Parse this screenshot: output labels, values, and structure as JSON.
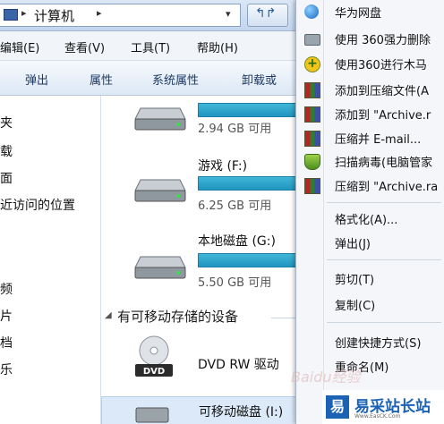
{
  "address_bar": {
    "path": "计算机",
    "arrow": "▸",
    "dropdown": "▾",
    "refresh": "↰↱"
  },
  "menu": {
    "items": [
      "编辑(E)",
      "查看(V)",
      "工具(T)",
      "帮助(H)"
    ]
  },
  "toolbar": {
    "buttons": [
      "弹出",
      "属性",
      "系统属性",
      "卸载或"
    ]
  },
  "nav_pane": {
    "items": [
      "夹",
      "载",
      "面",
      "近访问的位置",
      "频",
      "片",
      "档",
      "乐"
    ]
  },
  "drives": [
    {
      "name": "",
      "free": "2.94 GB 可用",
      "icon": "hard-drive-icon"
    },
    {
      "name": "游戏 (F:)",
      "free": "6.25 GB 可用",
      "icon": "hard-drive-icon"
    },
    {
      "name": "本地磁盘 (G:)",
      "free": "5.50 GB 可用",
      "icon": "hard-drive-icon"
    }
  ],
  "removable_group": {
    "header": "有可移动存储的设备",
    "items": [
      {
        "name": "DVD RW 驱动",
        "icon": "dvd-drive-icon",
        "badge": "DVD"
      },
      {
        "name": "可移动磁盘 (I:)",
        "icon": "removable-disk-icon"
      }
    ]
  },
  "context_menu": {
    "items": [
      {
        "label": "华为网盘",
        "icon": "globe-icon"
      },
      {
        "label": "使用 360强力删除",
        "icon": "shredder-icon"
      },
      {
        "label": "使用360进行木马",
        "icon": "360-plus-icon",
        "icon_glyph": "+"
      },
      {
        "label": "添加到压缩文件(A",
        "icon": "winrar-icon"
      },
      {
        "label": "添加到 \"Archive.r",
        "icon": "winrar-icon"
      },
      {
        "label": "压缩并 E-mail...",
        "icon": "winrar-icon"
      },
      {
        "label": "扫描病毒(电脑管家",
        "icon": "shield-icon"
      },
      {
        "label": "压缩到 \"Archive.ra",
        "icon": "winrar-icon"
      },
      {
        "label": "格式化(A)...",
        "icon": ""
      },
      {
        "label": "弹出(J)",
        "icon": ""
      },
      {
        "label": "剪切(T)",
        "icon": ""
      },
      {
        "label": "复制(C)",
        "icon": ""
      },
      {
        "label": "创建快捷方式(S)",
        "icon": ""
      },
      {
        "label": "重命名(M)",
        "icon": ""
      }
    ]
  },
  "watermark": {
    "baidu": "Baidu经验",
    "logo_glyph": "易",
    "site_name": "易采站长站",
    "site_url": "Www.EasCK.Com"
  },
  "colors": {
    "drive_bar": "#2aa6cf",
    "menu_bg": "#f4f6f9",
    "logo_blue": "#1b62b5"
  }
}
